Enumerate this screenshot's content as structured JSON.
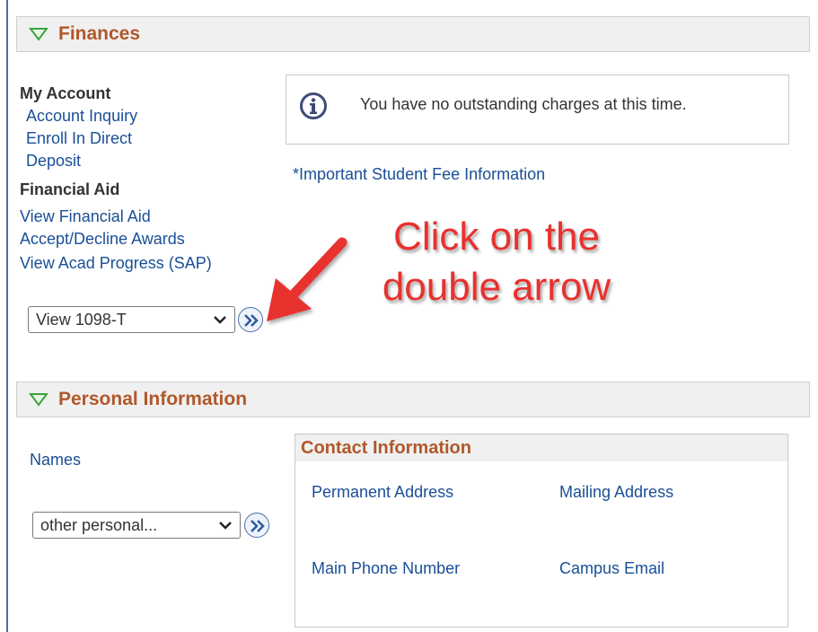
{
  "finances": {
    "header": "Finances",
    "my_account_label": "My Account",
    "my_account_links": [
      "Account Inquiry",
      "Enroll In Direct",
      "Deposit"
    ],
    "financial_aid_label": "Financial Aid",
    "financial_aid_links": [
      "View Financial Aid",
      "Accept/Decline Awards",
      "View Acad Progress (SAP)"
    ],
    "message": "You have no outstanding charges at this time.",
    "fee_link": "*Important Student Fee Information",
    "select_value": "View 1098-T"
  },
  "annotation": {
    "line1": "Click on the",
    "line2": "double arrow",
    "color": "#e8312f"
  },
  "personal": {
    "header": "Personal Information",
    "names_link": "Names",
    "select_value": "other personal..."
  },
  "contact": {
    "title": "Contact Information",
    "links": [
      "Permanent Address",
      "Mailing Address",
      "Main Phone Number",
      "Campus Email"
    ]
  },
  "colors": {
    "header_text": "#b0582a",
    "link": "#1a4f96",
    "triangle": "#3aa33a"
  }
}
